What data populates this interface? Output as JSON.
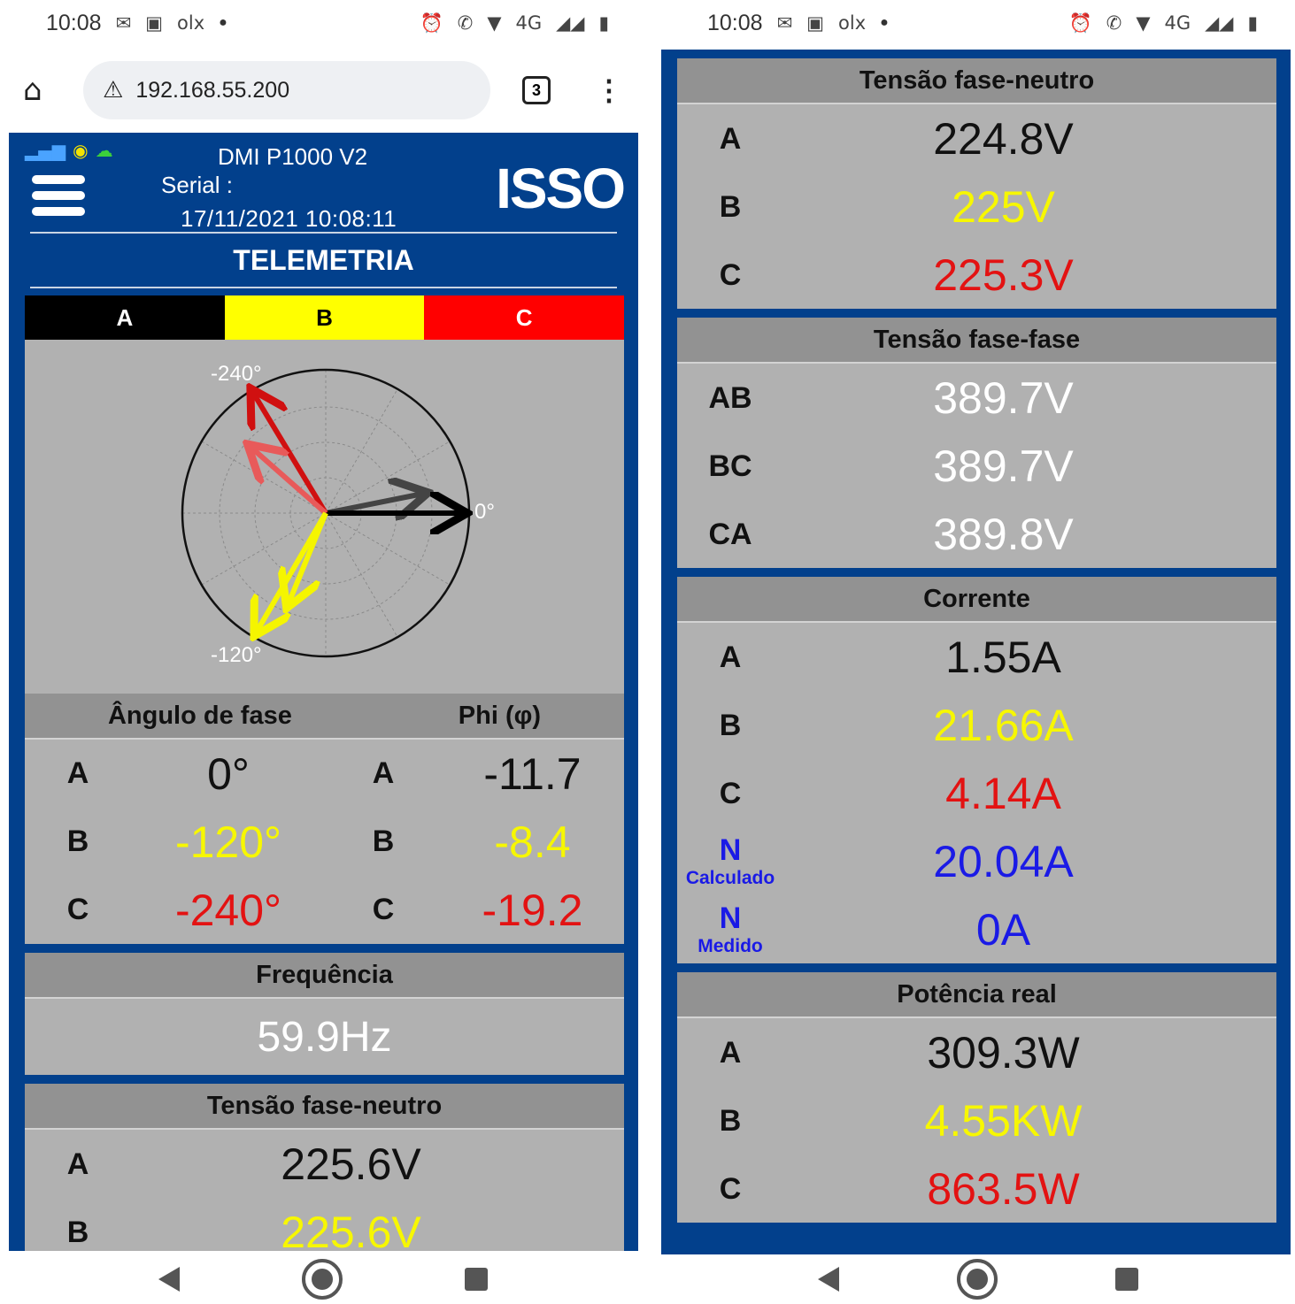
{
  "colors": {
    "phase_a": "#111111",
    "phase_b": "#f7f700",
    "phase_c": "#e31212",
    "neutral": "#1a1ae6",
    "background": "#02408c",
    "panel": "#b1b1b1"
  },
  "status_bar": {
    "time": "10:08",
    "icons": [
      "gmail-icon",
      "xp-icon",
      "olx-icon",
      "alarm-icon",
      "wifi-call-icon",
      "wifi-icon",
      "signal-icon",
      "battery-icon"
    ],
    "olx": "olx",
    "network": "4G"
  },
  "browser": {
    "url": "192.168.55.200",
    "tab_count": "3"
  },
  "header": {
    "device": "DMI P1000 V2",
    "serial_label": "Serial :",
    "datetime": "17/11/2021 10:08:11",
    "logo": "ISSO",
    "title": "TELEMETRIA"
  },
  "phase_tabs": [
    "A",
    "B",
    "C"
  ],
  "phasor": {
    "labels": {
      "top": "-240°",
      "right": "0°",
      "bottom": "-120°"
    }
  },
  "angles": {
    "header_left": "Ângulo de fase",
    "header_right": "Phi (φ)",
    "rows": [
      {
        "label": "A",
        "angle": "0°",
        "phi_label": "A",
        "phi": "-11.7"
      },
      {
        "label": "B",
        "angle": "-120°",
        "phi_label": "B",
        "phi": "-8.4"
      },
      {
        "label": "C",
        "angle": "-240°",
        "phi_label": "C",
        "phi": "-19.2"
      }
    ]
  },
  "frequency": {
    "title": "Frequência",
    "value": "59.9Hz"
  },
  "left_voltage": {
    "title": "Tensão fase-neutro",
    "rows": [
      {
        "label": "A",
        "value": "225.6V"
      },
      {
        "label": "B",
        "value": "225.6V"
      }
    ]
  },
  "right": {
    "voltage_pn": {
      "title": "Tensão fase-neutro",
      "rows": [
        {
          "label": "A",
          "value": "224.8V"
        },
        {
          "label": "B",
          "value": "225V"
        },
        {
          "label": "C",
          "value": "225.3V"
        }
      ]
    },
    "voltage_pp": {
      "title": "Tensão fase-fase",
      "rows": [
        {
          "label": "AB",
          "value": "389.7V"
        },
        {
          "label": "BC",
          "value": "389.7V"
        },
        {
          "label": "CA",
          "value": "389.8V"
        }
      ]
    },
    "current": {
      "title": "Corrente",
      "rows": [
        {
          "label": "A",
          "value": "1.55A"
        },
        {
          "label": "B",
          "value": "21.66A"
        },
        {
          "label": "C",
          "value": "4.14A"
        },
        {
          "label": "N",
          "sub": "Calculado",
          "value": "20.04A"
        },
        {
          "label": "N",
          "sub": "Medido",
          "value": "0A"
        }
      ]
    },
    "power": {
      "title": "Potência real",
      "rows": [
        {
          "label": "A",
          "value": "309.3W"
        },
        {
          "label": "B",
          "value": "4.55KW"
        },
        {
          "label": "C",
          "value": "863.5W"
        }
      ]
    }
  }
}
